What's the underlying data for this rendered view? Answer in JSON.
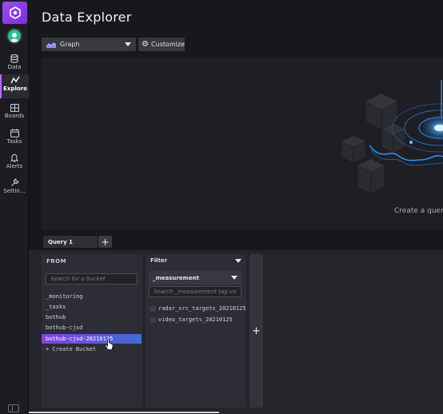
{
  "sidebar": {
    "items": [
      {
        "label": "Data",
        "icon": "database-icon"
      },
      {
        "label": "Explore",
        "icon": "explore-graph-icon",
        "active": true
      },
      {
        "label": "Boards",
        "icon": "dashboards-icon"
      },
      {
        "label": "Tasks",
        "icon": "calendar-icon"
      },
      {
        "label": "Alerts",
        "icon": "bell-icon"
      },
      {
        "label": "Settin...",
        "icon": "wrench-icon"
      }
    ]
  },
  "header": {
    "title": "Data Explorer"
  },
  "toolbar": {
    "graph_type": "Graph",
    "customize_label": "Customize"
  },
  "graph": {
    "empty_text": "Create a query"
  },
  "query_tabs": {
    "tabs": [
      "Query 1"
    ],
    "add_label": "+"
  },
  "from_panel": {
    "title": "FROM",
    "search_placeholder": "Search for a bucket",
    "buckets": [
      "_monitoring",
      "_tasks",
      "bothub",
      "bothub-cjsd",
      "bothub-cjsd-20210125"
    ],
    "selected_bucket": "bothub-cjsd-20210125",
    "create_label": "+ Create Bucket"
  },
  "filter_panel": {
    "title": "Filter",
    "key": "_measurement",
    "search_placeholder": "Search _measurement tag va",
    "values": [
      "radar_src_targets_20210125",
      "video_targets_20210125"
    ]
  },
  "add_filter_label": "+",
  "colors": {
    "accent_purple": "#9b4cf2",
    "accent_blue": "#3f6bd9",
    "avatar": "#22c38c",
    "background": "#17171c"
  }
}
